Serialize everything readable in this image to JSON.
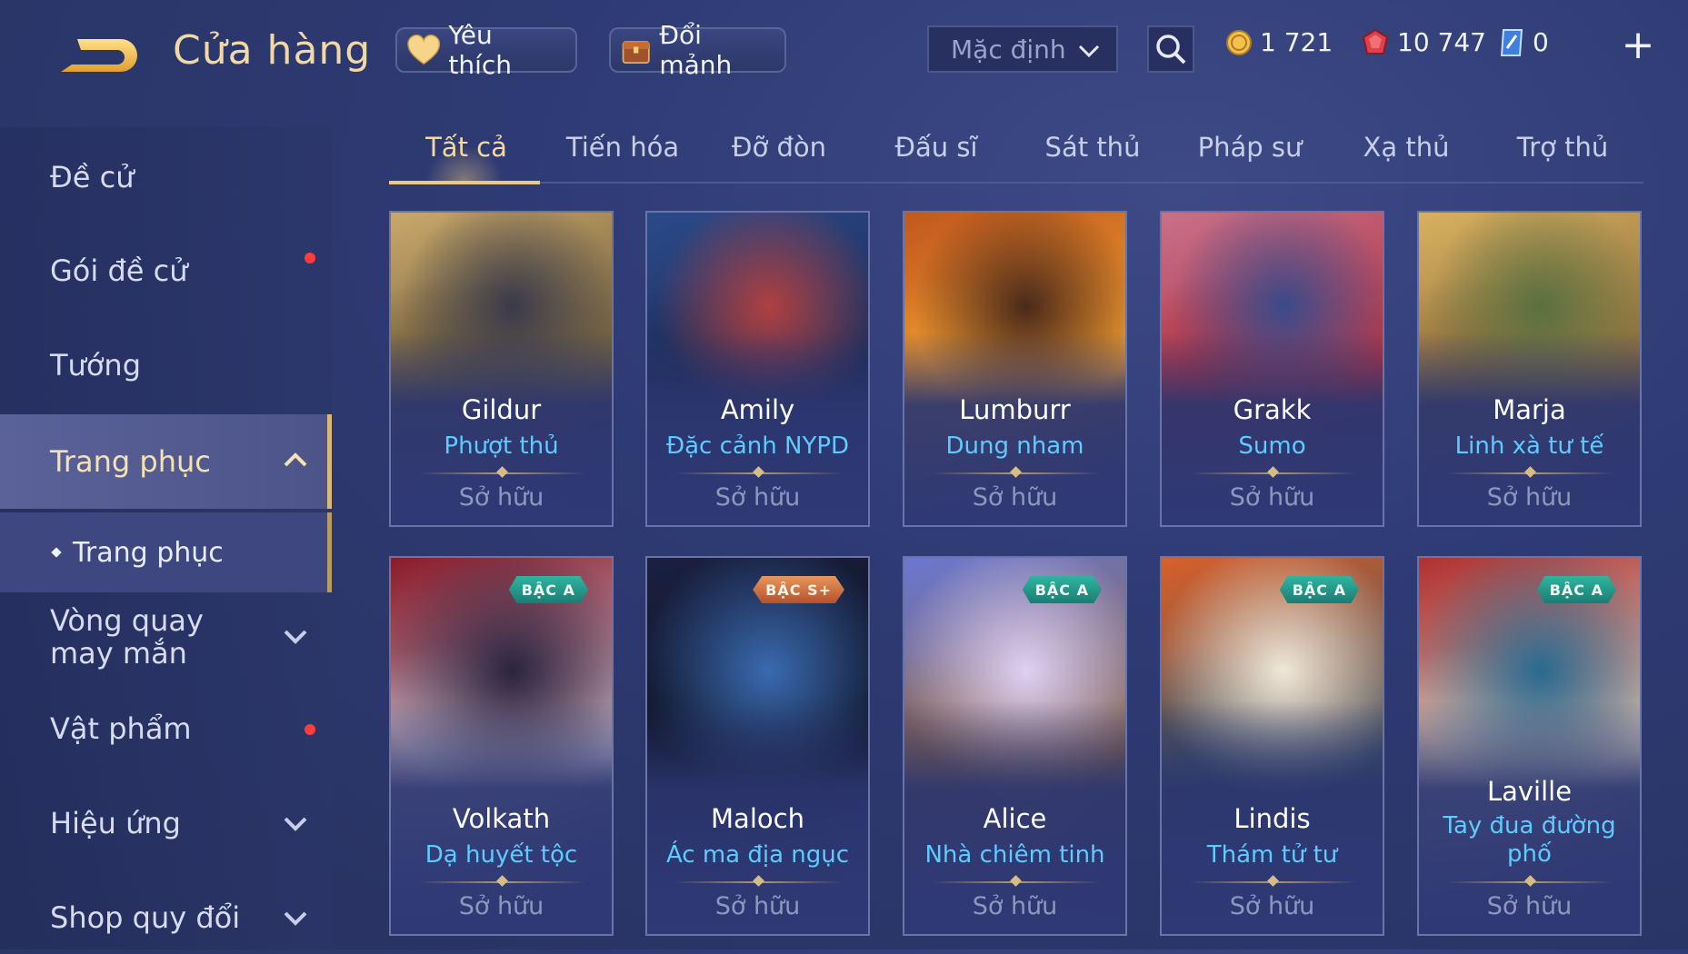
{
  "header": {
    "title": "Cửa hàng",
    "favorite_label": "Yêu thích",
    "exchange_label": "Đổi mảnh",
    "sort_value": "Mặc định",
    "gold": "1 721",
    "ruby": "10 747",
    "voucher": "0",
    "icons": {
      "back": "back-arrow-icon",
      "favorite": "heart-icon",
      "exchange": "chest-icon",
      "search": "search-icon",
      "gold": "gold-coin-icon",
      "ruby": "ruby-gem-icon",
      "voucher": "voucher-icon",
      "plus": "plus-icon"
    }
  },
  "sidebar": {
    "items": [
      {
        "label": "Đề cử"
      },
      {
        "label": "Gói đề cử"
      },
      {
        "label": "Tướng"
      },
      {
        "label": "Trang phục"
      },
      {
        "label": "Trang phục"
      },
      {
        "label": "Vòng quay may mắn"
      },
      {
        "label": "Vật phẩm"
      },
      {
        "label": "Hiệu ứng"
      },
      {
        "label": "Shop quy đổi"
      }
    ]
  },
  "tabs": [
    "Tất cả",
    "Tiến hóa",
    "Đỡ đòn",
    "Đấu sĩ",
    "Sát thủ",
    "Pháp sư",
    "Xạ thủ",
    "Trợ thủ"
  ],
  "active_tab": "Tất cả",
  "cards": [
    {
      "name": "Gildur",
      "skin": "Phượt thủ",
      "status": "Sở hữu",
      "badge": "",
      "colors": [
        "#c9a86a",
        "#3a3a4a",
        "#6b5a3a"
      ]
    },
    {
      "name": "Amily",
      "skin": "Đặc cảnh NYPD",
      "status": "Sở hữu",
      "badge": "",
      "colors": [
        "#2b4a8a",
        "#b04040",
        "#1c2a55"
      ]
    },
    {
      "name": "Lumburr",
      "skin": "Dung nham",
      "status": "Sở hữu",
      "badge": "",
      "colors": [
        "#c2581e",
        "#4a2a1a",
        "#f0a030"
      ]
    },
    {
      "name": "Grakk",
      "skin": "Sumo",
      "status": "Sở hữu",
      "badge": "",
      "colors": [
        "#c8708a",
        "#3a4a8a",
        "#b03040"
      ]
    },
    {
      "name": "Marja",
      "skin": "Linh xà tư tế",
      "status": "Sở hữu",
      "badge": "",
      "colors": [
        "#d8b060",
        "#5a7040",
        "#8a6a3a"
      ]
    },
    {
      "name": "Volkath",
      "skin": "Dạ huyết tộc",
      "status": "Sở hữu",
      "badge": "BẬC A",
      "badge_type": "a",
      "colors": [
        "#8a1a2a",
        "#2a2440",
        "#c8c0d0"
      ]
    },
    {
      "name": "Maloch",
      "skin": "Ác ma địa ngục",
      "status": "Sở hữu",
      "badge": "BẬC S+",
      "badge_type": "s",
      "colors": [
        "#1a2040",
        "#3a6ab0",
        "#0c1020"
      ]
    },
    {
      "name": "Alice",
      "skin": "Nhà chiêm tinh",
      "status": "Sở hữu",
      "badge": "BẬC A",
      "badge_type": "a",
      "colors": [
        "#6a78d0",
        "#e0d0f0",
        "#8a6040"
      ]
    },
    {
      "name": "Lindis",
      "skin": "Thám tử tư",
      "status": "Sở hữu",
      "badge": "BẬC A",
      "badge_type": "a",
      "colors": [
        "#d8602a",
        "#f0e8d8",
        "#3a5060"
      ]
    },
    {
      "name": "Laville",
      "skin": "Tay đua đường phố",
      "status": "Sở hữu",
      "badge": "BẬC A",
      "badge_type": "a",
      "colors": [
        "#b03030",
        "#2a6a90",
        "#d8d0c0"
      ]
    }
  ]
}
